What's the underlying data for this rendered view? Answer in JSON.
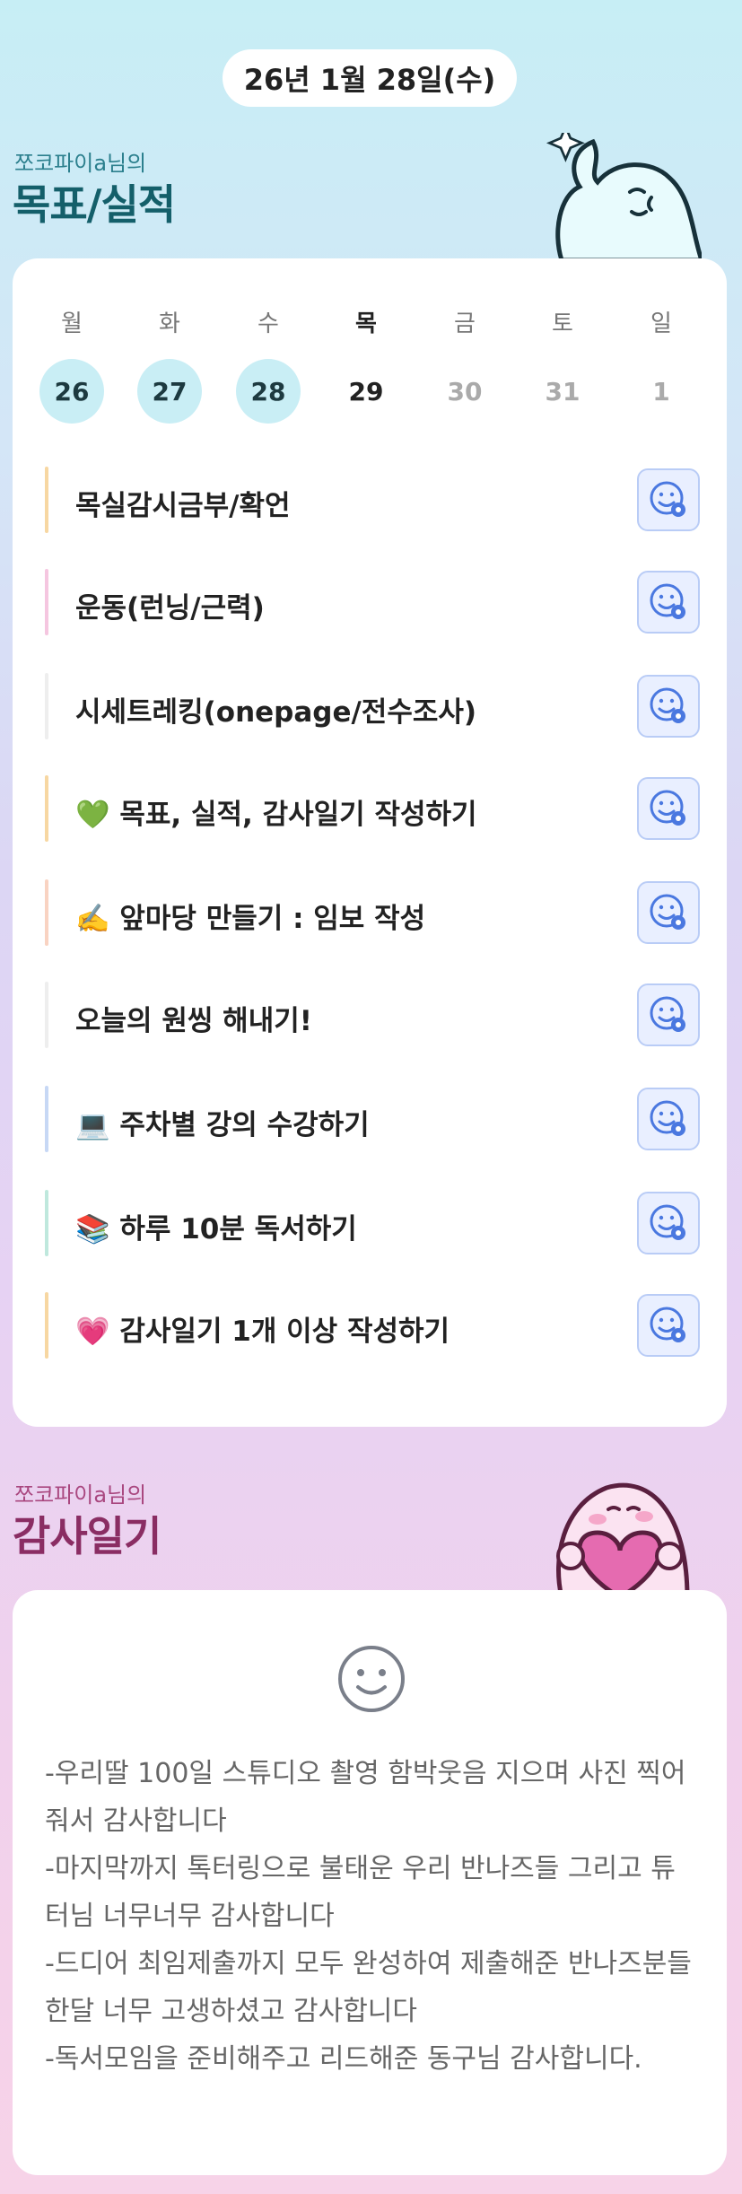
{
  "header": {
    "date": "26년 1월 28일(수)"
  },
  "goals_section": {
    "owner": "쪼코파이a님의",
    "title": "목표/실적"
  },
  "calendar": {
    "weekdays": [
      "월",
      "화",
      "수",
      "목",
      "금",
      "토",
      "일"
    ],
    "dates": [
      "26",
      "27",
      "28",
      "29",
      "30",
      "31",
      "1"
    ],
    "completed_dates": [
      "26",
      "27",
      "28"
    ],
    "today": "29"
  },
  "goals": [
    {
      "label": "목실감시금부/확언",
      "bar_color": "#f7d7a2"
    },
    {
      "label": "운동(런닝/근력)",
      "bar_color": "#f5c6e0"
    },
    {
      "label": "시세트레킹(onepage/전수조사)",
      "bar_color": "#eeeeee"
    },
    {
      "label": "💚 목표, 실적, 감사일기 작성하기",
      "bar_color": "#f7d7a2"
    },
    {
      "label": "✍️ 앞마당 만들기 : 임보 작성",
      "bar_color": "#f9d3c2"
    },
    {
      "label": "오늘의 원씽 해내기!",
      "bar_color": "#eeeeee"
    },
    {
      "label": "💻 주차별 강의 수강하기",
      "bar_color": "#c7d8f5"
    },
    {
      "label": "📚 하루 10분 독서하기",
      "bar_color": "#bfe8dd"
    },
    {
      "label": "💗 감사일기 1개 이상 작성하기",
      "bar_color": "#f7d7a2"
    }
  ],
  "gratitude_section": {
    "owner": "쪼코파이a님의",
    "title": "감사일기"
  },
  "gratitude": {
    "lines": [
      "-우리딸 100일 스튜디오 촬영 함박웃음 지으며 사진 찍어줘서 감사합니다",
      "-마지막까지 톡터링으로 불태운 우리 반나즈들 그리고 튜터님 너무너무 감사합니다",
      "-드디어 최임제출까지 모두 완성하여 제출해준 반나즈분들 한달 너무 고생하셨고 감사합니다",
      "-독서모임을 준비해주고 리드해준 동구님 감사합니다."
    ]
  },
  "colors": {
    "accent_done": "#c9eef5",
    "check_bg": "#e9efff",
    "check_icon": "#4a78e0"
  },
  "icons": {
    "mascot_top": "ghost-mascot-icon",
    "mascot_bottom": "heart-mascot-icon",
    "check": "smile-check-icon",
    "diary": "smile-icon"
  }
}
